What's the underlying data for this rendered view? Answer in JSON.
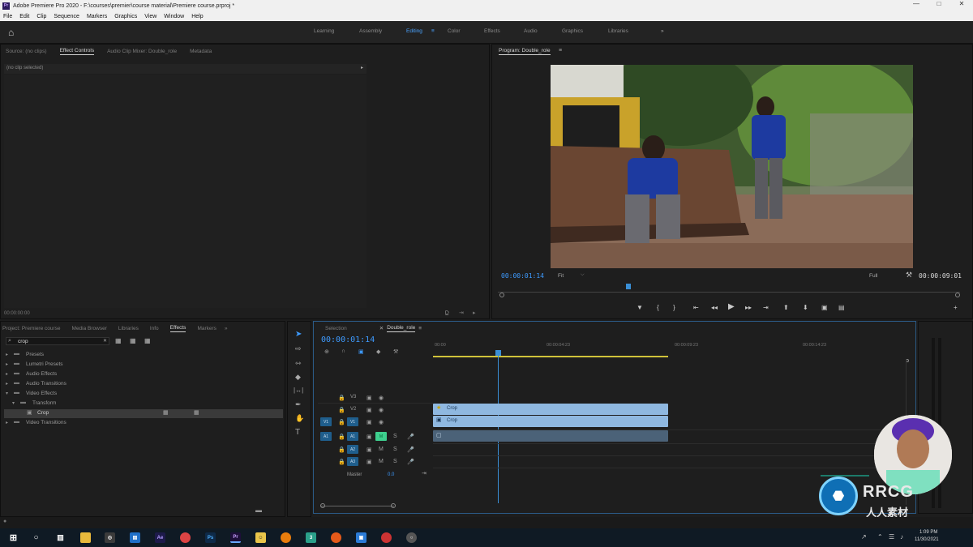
{
  "titlebar": {
    "title": "Adobe Premiere Pro 2020 - F:\\courses\\premier\\course material\\Premiere course.prproj *",
    "app_icon": "Pr"
  },
  "menu": [
    "File",
    "Edit",
    "Clip",
    "Sequence",
    "Markers",
    "Graphics",
    "View",
    "Window",
    "Help"
  ],
  "workspaces": [
    {
      "label": "Learning",
      "active": false
    },
    {
      "label": "Assembly",
      "active": false
    },
    {
      "label": "Editing",
      "active": true
    },
    {
      "label": "Color",
      "active": false
    },
    {
      "label": "Effects",
      "active": false
    },
    {
      "label": "Audio",
      "active": false
    },
    {
      "label": "Graphics",
      "active": false
    },
    {
      "label": "Libraries",
      "active": false
    }
  ],
  "source_panel": {
    "tabs": [
      "Source: (no clips)",
      "Effect Controls",
      "Audio Clip Mixer: Double_role",
      "Metadata"
    ],
    "active_tab": "Effect Controls",
    "no_clip_label": "(no clip selected)",
    "timecode": "00:00:00:00"
  },
  "program_monitor": {
    "tab": "Program: Double_role",
    "current_timecode": "00:00:01:14",
    "fit_label": "Fit",
    "quality_label": "Full",
    "duration_timecode": "00:00:09:01"
  },
  "project_panel": {
    "tabs": [
      "Project: Premiere course",
      "Media Browser",
      "Libraries",
      "Info",
      "Effects",
      "Markers"
    ],
    "active_tab": "Effects",
    "search_value": "crop",
    "tree": [
      {
        "label": "Presets",
        "indent": 0,
        "expanded": false
      },
      {
        "label": "Lumetri Presets",
        "indent": 0,
        "expanded": false
      },
      {
        "label": "Audio Effects",
        "indent": 0,
        "expanded": false
      },
      {
        "label": "Audio Transitions",
        "indent": 0,
        "expanded": false
      },
      {
        "label": "Video Effects",
        "indent": 0,
        "expanded": true
      },
      {
        "label": "Transform",
        "indent": 1,
        "expanded": true
      },
      {
        "label": "Crop",
        "indent": 2,
        "expanded": false,
        "selected": true
      },
      {
        "label": "Video Transitions",
        "indent": 0,
        "expanded": false
      }
    ]
  },
  "timeline": {
    "tabs": [
      "Selection",
      "Double_role"
    ],
    "active_tab": "Double_role",
    "current_timecode": "00:00:01:14",
    "ruler_ticks": [
      "00:00",
      "00:00:04:23",
      "00:00:09:23",
      "00:00:14:23"
    ],
    "video_tracks": [
      "V3",
      "V2",
      "V1"
    ],
    "audio_tracks": [
      "A1",
      "A2",
      "A3"
    ],
    "master_label": "Master",
    "master_value": "0.0",
    "clips": [
      {
        "track": "V3",
        "label": "Crop"
      },
      {
        "track": "V2",
        "label": "Crop"
      }
    ]
  },
  "tools": [
    "selection-tool",
    "track-select-tool",
    "ripple-edit-tool",
    "razor-tool",
    "slip-tool",
    "pen-tool",
    "hand-tool",
    "type-tool"
  ],
  "webcam_overlay": {
    "brand": "RRCG",
    "subtitle": "人人素材"
  },
  "watermark_text": "RRCG",
  "watermark_cn": "人人素材",
  "taskbar": {
    "time": "1:09 PM",
    "date": "11/30/2021",
    "apps": [
      "windows-start",
      "search",
      "task-view",
      "file-explorer",
      "chrome",
      "store",
      "after-effects",
      "chrome-alt",
      "photoshop",
      "premiere",
      "app-x",
      "blender",
      "app-y",
      "firefox",
      "app-z",
      "chrome-3",
      "app-w"
    ]
  },
  "colors": {
    "accent_blue": "#3e9bff",
    "clip_blue": "#8fb8e0",
    "playhead": "#3a8fd6",
    "work_area": "#cfc23a"
  }
}
